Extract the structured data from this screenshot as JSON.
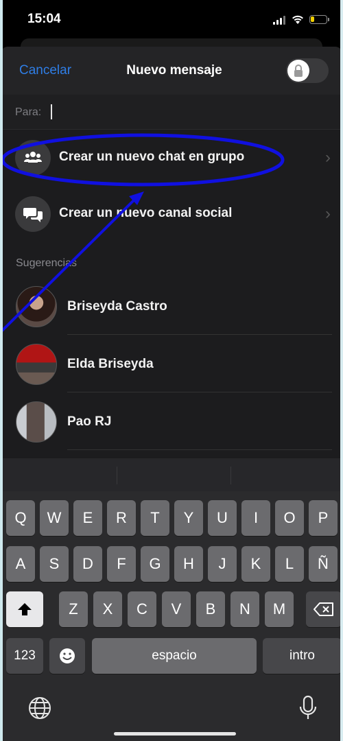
{
  "status_bar": {
    "time": "15:04",
    "battery_level": 0.25,
    "battery_color": "#f2d000"
  },
  "header": {
    "cancel_label": "Cancelar",
    "title": "Nuevo mensaje",
    "lock_icon": "lock-icon"
  },
  "to_field": {
    "label": "Para:",
    "value": ""
  },
  "actions": [
    {
      "label": "Crear un nuevo chat en grupo",
      "icon": "group-icon"
    },
    {
      "label": "Crear un nuevo canal social",
      "icon": "chat-bubbles-icon"
    }
  ],
  "suggestions": {
    "label": "Sugerencias",
    "contacts": [
      {
        "name": "Briseyda Castro"
      },
      {
        "name": "Elda Briseyda"
      },
      {
        "name": "Pao RJ"
      }
    ]
  },
  "keyboard": {
    "row1": [
      "Q",
      "W",
      "E",
      "R",
      "T",
      "Y",
      "U",
      "I",
      "O",
      "P"
    ],
    "row2": [
      "A",
      "S",
      "D",
      "F",
      "G",
      "H",
      "J",
      "K",
      "L",
      "Ñ"
    ],
    "row3": [
      "Z",
      "X",
      "C",
      "V",
      "B",
      "N",
      "M"
    ],
    "numbers_label": "123",
    "space_label": "espacio",
    "return_label": "intro",
    "shift_icon": "shift-icon",
    "delete_icon": "delete-icon",
    "emoji_icon": "emoji-icon",
    "globe_icon": "globe-icon",
    "mic_icon": "microphone-icon"
  },
  "colors": {
    "accent": "#2f7ee6",
    "annotation": "#1010e0"
  }
}
